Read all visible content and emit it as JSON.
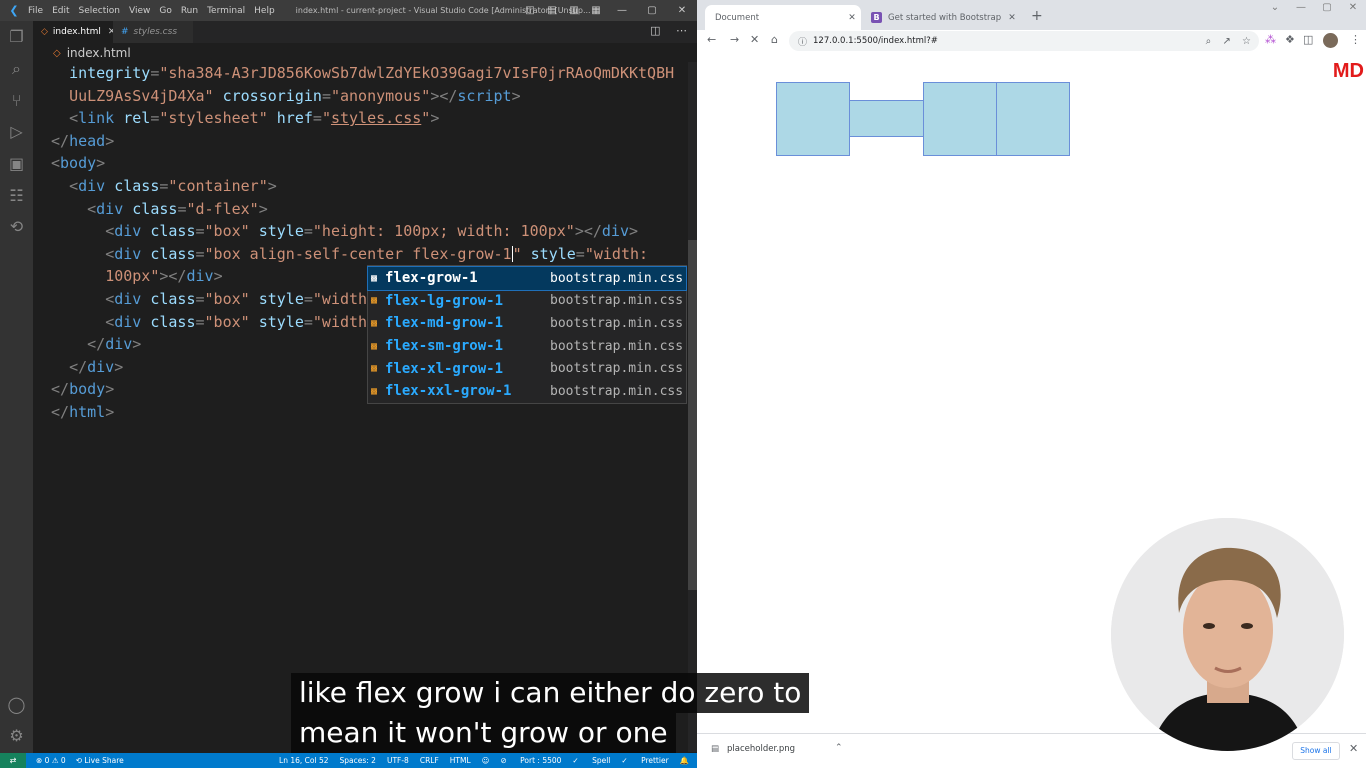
{
  "vscode": {
    "menu": [
      "File",
      "Edit",
      "Selection",
      "View",
      "Go",
      "Run",
      "Terminal",
      "Help"
    ],
    "window_title": "index.html - current-project - Visual Studio Code [Administrator] [Unsup...",
    "tabs": [
      {
        "label": "index.html",
        "active": true
      },
      {
        "label": "styles.css",
        "active": false
      }
    ],
    "breadcrumb": "index.html",
    "code_lines": [
      {
        "indent": "  ",
        "tokens": [
          [
            "at",
            "integrity"
          ],
          [
            "pu",
            "="
          ],
          [
            "st",
            "\"sha384-A3rJD856KowSb7dwlZdYEkO39Gagi7vIsF0jrRAoQmDKKtQBH"
          ]
        ]
      },
      {
        "indent": "  ",
        "tokens": [
          [
            "st",
            "UuLZ9AsSv4jD4Xa\""
          ],
          [
            "tx",
            " "
          ],
          [
            "at",
            "crossorigin"
          ],
          [
            "pu",
            "="
          ],
          [
            "st",
            "\"anonymous\""
          ],
          [
            "pu",
            "></"
          ],
          [
            "tg",
            "script"
          ],
          [
            "pu",
            ">"
          ]
        ]
      },
      {
        "indent": "  ",
        "tokens": [
          [
            "pu",
            "<"
          ],
          [
            "tg",
            "link"
          ],
          [
            "tx",
            " "
          ],
          [
            "at",
            "rel"
          ],
          [
            "pu",
            "="
          ],
          [
            "st",
            "\"stylesheet\""
          ],
          [
            "tx",
            " "
          ],
          [
            "at",
            "href"
          ],
          [
            "pu",
            "="
          ],
          [
            "st",
            "\""
          ],
          [
            "stu",
            "styles.css"
          ],
          [
            "st",
            "\""
          ],
          [
            "pu",
            ">"
          ]
        ]
      },
      {
        "indent": "",
        "tokens": [
          [
            "pu",
            "</"
          ],
          [
            "tg",
            "head"
          ],
          [
            "pu",
            ">"
          ]
        ]
      },
      {
        "indent": "",
        "tokens": [
          [
            "pu",
            "<"
          ],
          [
            "tg",
            "body"
          ],
          [
            "pu",
            ">"
          ]
        ]
      },
      {
        "indent": "  ",
        "tokens": [
          [
            "pu",
            "<"
          ],
          [
            "tg",
            "div"
          ],
          [
            "tx",
            " "
          ],
          [
            "at",
            "class"
          ],
          [
            "pu",
            "="
          ],
          [
            "st",
            "\"container\""
          ],
          [
            "pu",
            ">"
          ]
        ]
      },
      {
        "indent": "    ",
        "tokens": [
          [
            "pu",
            "<"
          ],
          [
            "tg",
            "div"
          ],
          [
            "tx",
            " "
          ],
          [
            "at",
            "class"
          ],
          [
            "pu",
            "="
          ],
          [
            "st",
            "\"d-flex\""
          ],
          [
            "pu",
            ">"
          ]
        ]
      },
      {
        "indent": "      ",
        "tokens": [
          [
            "pu",
            "<"
          ],
          [
            "tg",
            "div"
          ],
          [
            "tx",
            " "
          ],
          [
            "at",
            "class"
          ],
          [
            "pu",
            "="
          ],
          [
            "st",
            "\"box\""
          ],
          [
            "tx",
            " "
          ],
          [
            "at",
            "style"
          ],
          [
            "pu",
            "="
          ],
          [
            "st",
            "\"height: 100px; width: 100px\""
          ],
          [
            "pu",
            "></"
          ],
          [
            "tg",
            "div"
          ],
          [
            "pu",
            ">"
          ]
        ]
      },
      {
        "indent": "      ",
        "tokens": [
          [
            "pu",
            "<"
          ],
          [
            "tg",
            "div"
          ],
          [
            "tx",
            " "
          ],
          [
            "at",
            "class"
          ],
          [
            "pu",
            "="
          ],
          [
            "st",
            "\"box align-self-center flex-grow-1"
          ],
          [
            "cur",
            ""
          ],
          [
            "st",
            "\""
          ],
          [
            "tx",
            " "
          ],
          [
            "at",
            "style"
          ],
          [
            "pu",
            "="
          ],
          [
            "st",
            "\"width:"
          ]
        ]
      },
      {
        "indent": "      ",
        "tokens": [
          [
            "st",
            "100px\""
          ],
          [
            "pu",
            "></"
          ],
          [
            "tg",
            "div"
          ],
          [
            "pu",
            ">"
          ]
        ]
      },
      {
        "indent": "      ",
        "tokens": [
          [
            "pu",
            "<"
          ],
          [
            "tg",
            "div"
          ],
          [
            "tx",
            " "
          ],
          [
            "at",
            "class"
          ],
          [
            "pu",
            "="
          ],
          [
            "st",
            "\"box\""
          ],
          [
            "tx",
            " "
          ],
          [
            "at",
            "style"
          ],
          [
            "pu",
            "="
          ],
          [
            "st",
            "\"width"
          ]
        ]
      },
      {
        "indent": "      ",
        "tokens": [
          [
            "pu",
            "<"
          ],
          [
            "tg",
            "div"
          ],
          [
            "tx",
            " "
          ],
          [
            "at",
            "class"
          ],
          [
            "pu",
            "="
          ],
          [
            "st",
            "\"box\""
          ],
          [
            "tx",
            " "
          ],
          [
            "at",
            "style"
          ],
          [
            "pu",
            "="
          ],
          [
            "st",
            "\"width"
          ]
        ]
      },
      {
        "indent": "    ",
        "tokens": [
          [
            "pu",
            "</"
          ],
          [
            "tg",
            "div"
          ],
          [
            "pu",
            ">"
          ]
        ]
      },
      {
        "indent": "  ",
        "tokens": [
          [
            "pu",
            "</"
          ],
          [
            "tg",
            "div"
          ],
          [
            "pu",
            ">"
          ]
        ]
      },
      {
        "indent": "",
        "tokens": [
          [
            "pu",
            "</"
          ],
          [
            "tg",
            "body"
          ],
          [
            "pu",
            ">"
          ]
        ]
      },
      {
        "indent": "",
        "tokens": [
          [
            "pu",
            "</"
          ],
          [
            "tg",
            "html"
          ],
          [
            "pu",
            ">"
          ]
        ]
      }
    ],
    "suggestions": [
      {
        "match": "flex-",
        "rest": "grow-1",
        "name": "flex-grow-1",
        "source": "bootstrap.min.css",
        "selected": true
      },
      {
        "name": "flex-lg-grow-1",
        "source": "bootstrap.min.css",
        "selected": false
      },
      {
        "name": "flex-md-grow-1",
        "source": "bootstrap.min.css",
        "selected": false
      },
      {
        "name": "flex-sm-grow-1",
        "source": "bootstrap.min.css",
        "selected": false
      },
      {
        "name": "flex-xl-grow-1",
        "source": "bootstrap.min.css",
        "selected": false
      },
      {
        "name": "flex-xxl-grow-1",
        "source": "bootstrap.min.css",
        "selected": false
      }
    ],
    "status": {
      "remote": "⇄",
      "problems": "⊗ 0 ⚠ 0",
      "live_share": "Live Share",
      "position": "Ln 16, Col 52",
      "spaces": "Spaces: 2",
      "encoding": "UTF-8",
      "eol": "CRLF",
      "language": "HTML",
      "port": "Port : 5500",
      "spell": "Spell",
      "prettier": "Prettier"
    }
  },
  "chrome": {
    "tabs": [
      {
        "title": "Document",
        "active": true
      },
      {
        "title": "Get started with Bootstrap · Boot",
        "active": false
      }
    ],
    "url": "127.0.0.1:5500/index.html?#",
    "download_file": "placeholder.png",
    "show_all": "Show all",
    "logo_text": "MD",
    "colors": {
      "box_fill": "#add8e6",
      "box_border": "#6a8fd9",
      "logo": "#e21b1b"
    }
  },
  "subtitle": {
    "line1": "like flex grow i can either do zero to",
    "line2": "mean it won't grow or one"
  }
}
